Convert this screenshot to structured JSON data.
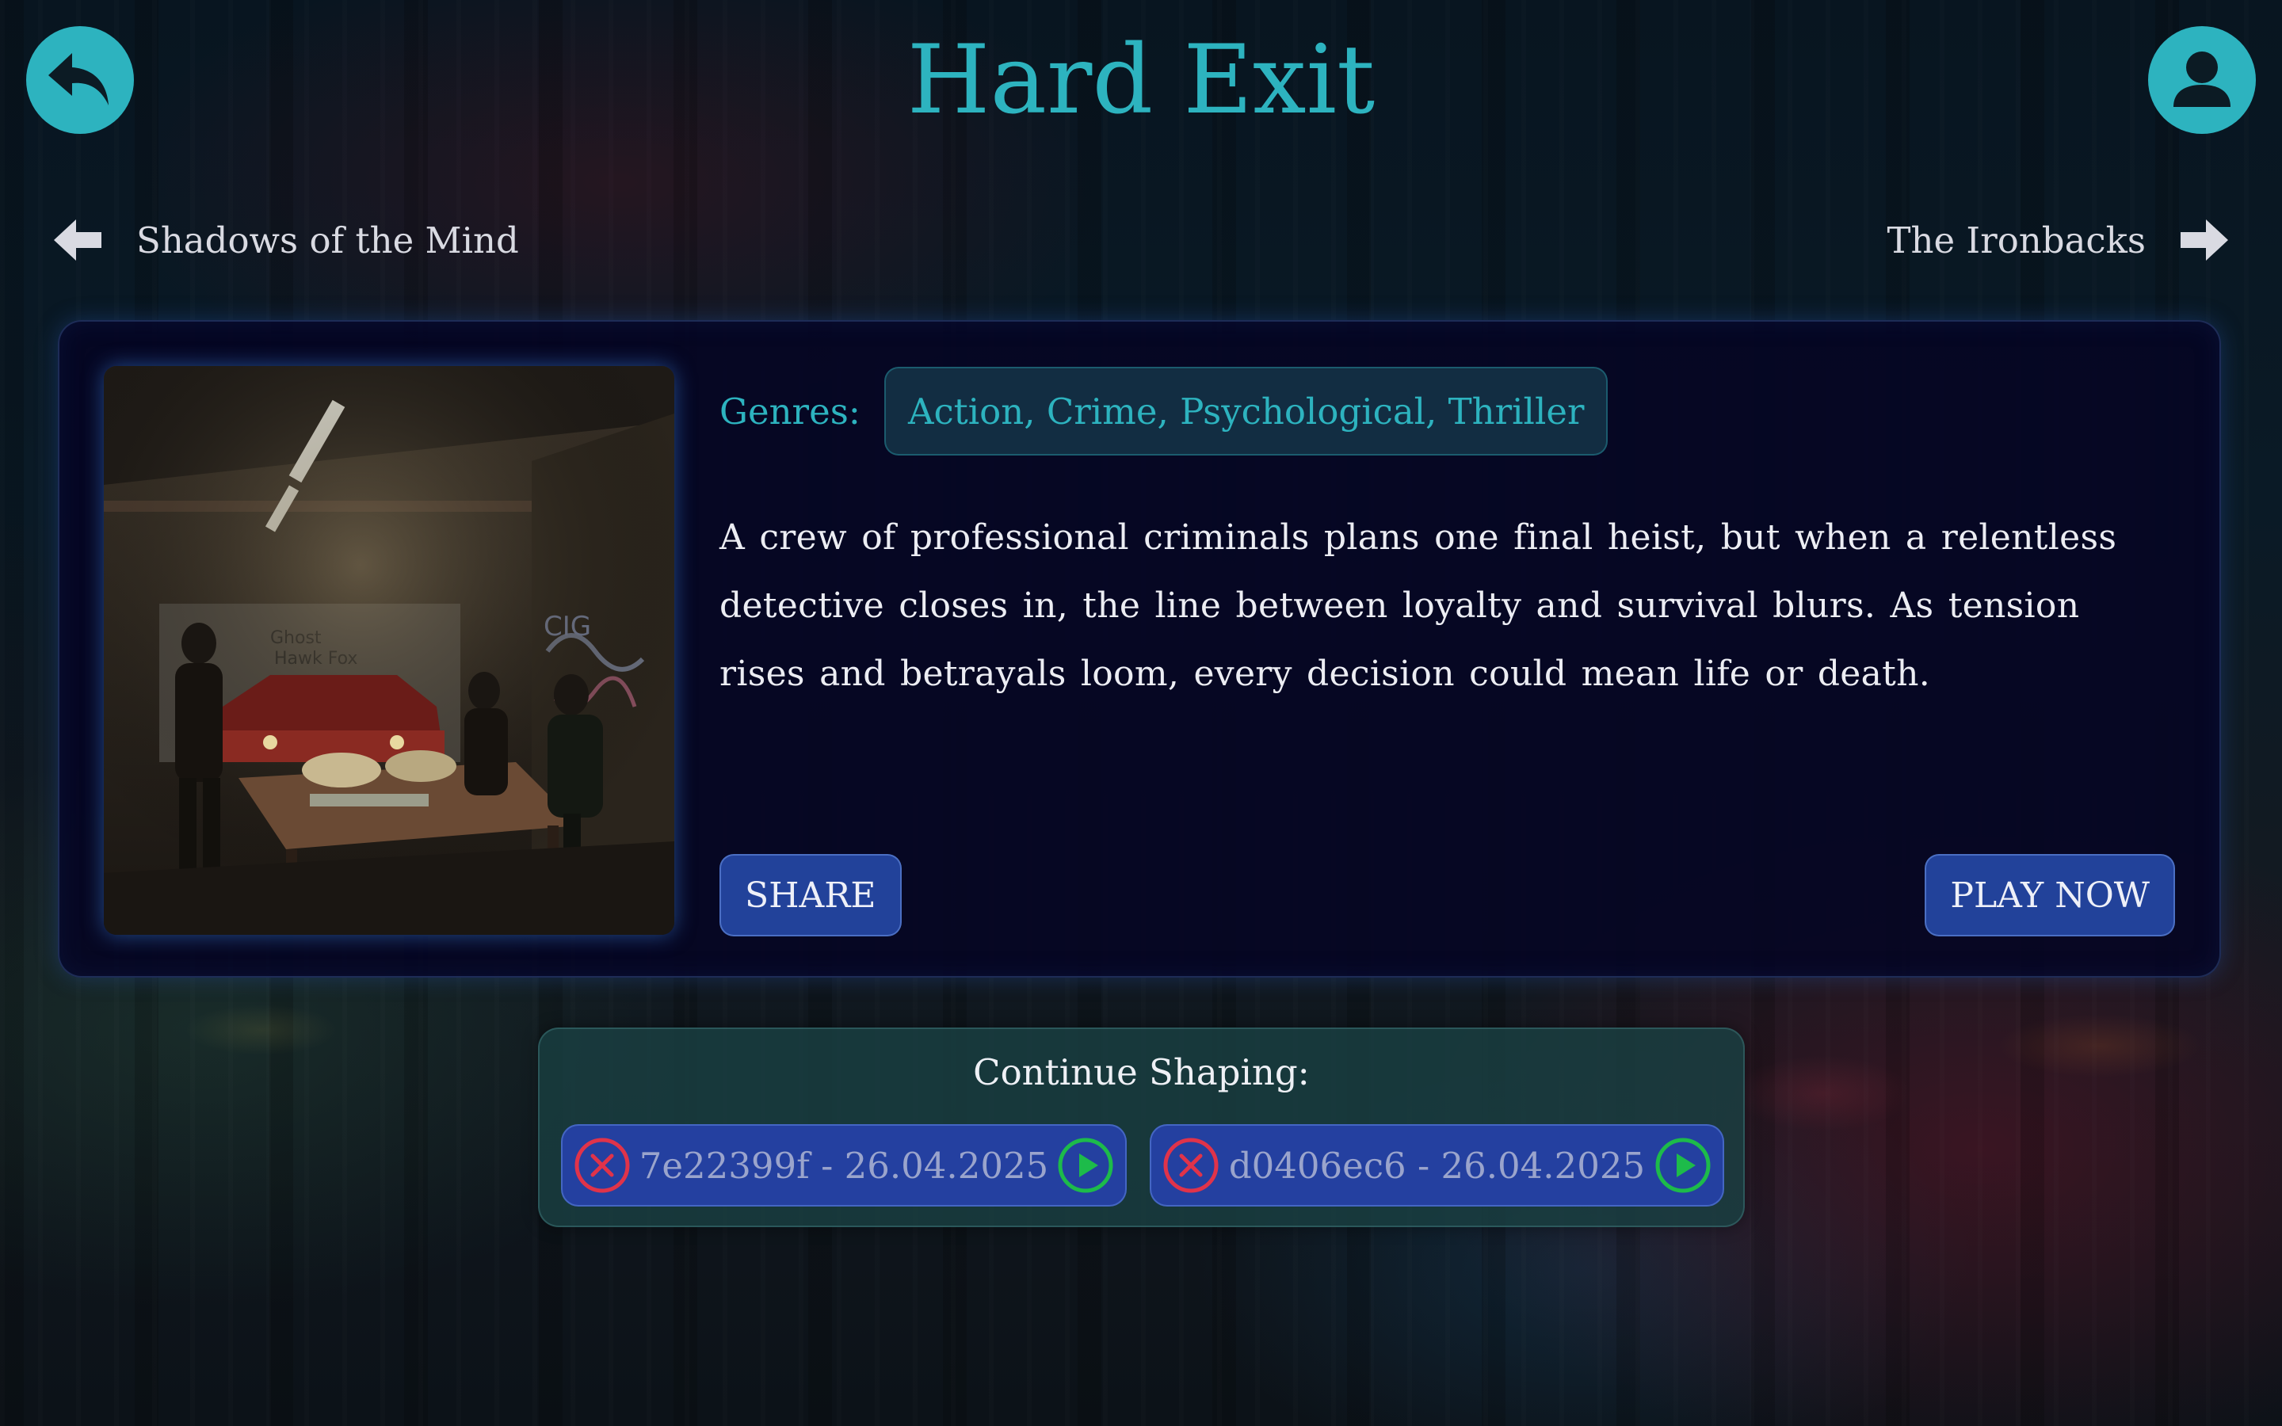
{
  "header": {
    "title": "Hard Exit",
    "back_icon": "back-arrow-icon",
    "profile_icon": "user-profile-icon",
    "accent_color": "#2db3bf"
  },
  "navigation": {
    "previous": {
      "label": "Shadows of the Mind",
      "icon": "arrow-left-icon"
    },
    "next": {
      "label": "The Ironbacks",
      "icon": "arrow-right-icon"
    }
  },
  "story": {
    "cover_image": "cover-image",
    "genres_label": "Genres:",
    "genres": "Action, Crime, Psychological, Thriller",
    "description": "A crew of professional criminals plans one final heist, but when a relentless detective closes in, the line between loyalty and survival blurs. As tension rises and betrayals loom, every decision could mean life or death.",
    "share_label": "SHARE",
    "play_label": "PLAY NOW",
    "button_color": "#22429a"
  },
  "continue_shaping": {
    "title": "Continue Shaping:",
    "sessions": [
      {
        "label": "7e22399f - 26.04.2025",
        "delete_icon": "close-circle-icon",
        "resume_icon": "play-circle-icon"
      },
      {
        "label": "d0406ec6 - 26.04.2025",
        "delete_icon": "close-circle-icon",
        "resume_icon": "play-circle-icon"
      }
    ],
    "delete_color": "#e0334a",
    "resume_color": "#1dbb4a"
  }
}
